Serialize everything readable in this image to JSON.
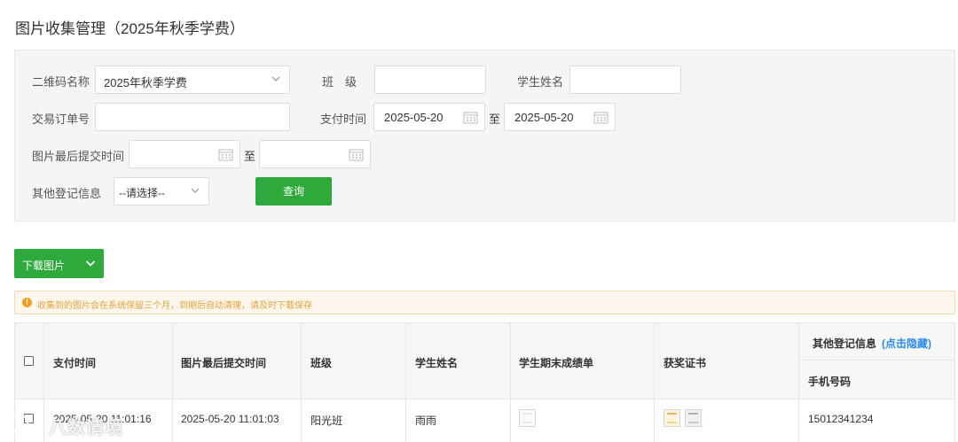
{
  "page": {
    "title": "图片收集管理（2025年秋季学费）"
  },
  "filters": {
    "qr_name_label": "二维码名称",
    "qr_name_value": "2025年秋季学费",
    "class_label": "班　级",
    "class_value": "",
    "student_name_label": "学生姓名",
    "student_name_value": "",
    "order_no_label": "交易订单号",
    "order_no_value": "",
    "pay_time_label": "支付时间",
    "pay_time_from": "2025-05-20",
    "pay_time_to": "2025-05-20",
    "range_sep": "至",
    "submit_time_label": "图片最后提交时间",
    "submit_time_from": "",
    "submit_time_to": "",
    "other_info_label": "其他登记信息",
    "other_info_value": "--请选择--",
    "query_label": "查询"
  },
  "toolbar": {
    "download_label": "下载图片"
  },
  "notice": {
    "text": "收集到的图片会在系统保留三个月，到期后自动清理，请及时下载保存"
  },
  "table": {
    "headers": {
      "pay_time": "支付时间",
      "submit_time": "图片最后提交时间",
      "class": "班级",
      "student_name": "学生姓名",
      "final_grades": "学生期末成绩单",
      "award_cert": "获奖证书",
      "other_info": "其他登记信息",
      "hide_link": "(点击隐藏)",
      "phone": "手机号码"
    },
    "rows": [
      {
        "pay_time": "2025-05-20 11:01:16",
        "submit_time": "2025-05-20 11:01:03",
        "class": "阳光班",
        "student_name": "雨雨",
        "phone": "15012341234"
      }
    ]
  },
  "watermark": {
    "text": "八数情境"
  }
}
